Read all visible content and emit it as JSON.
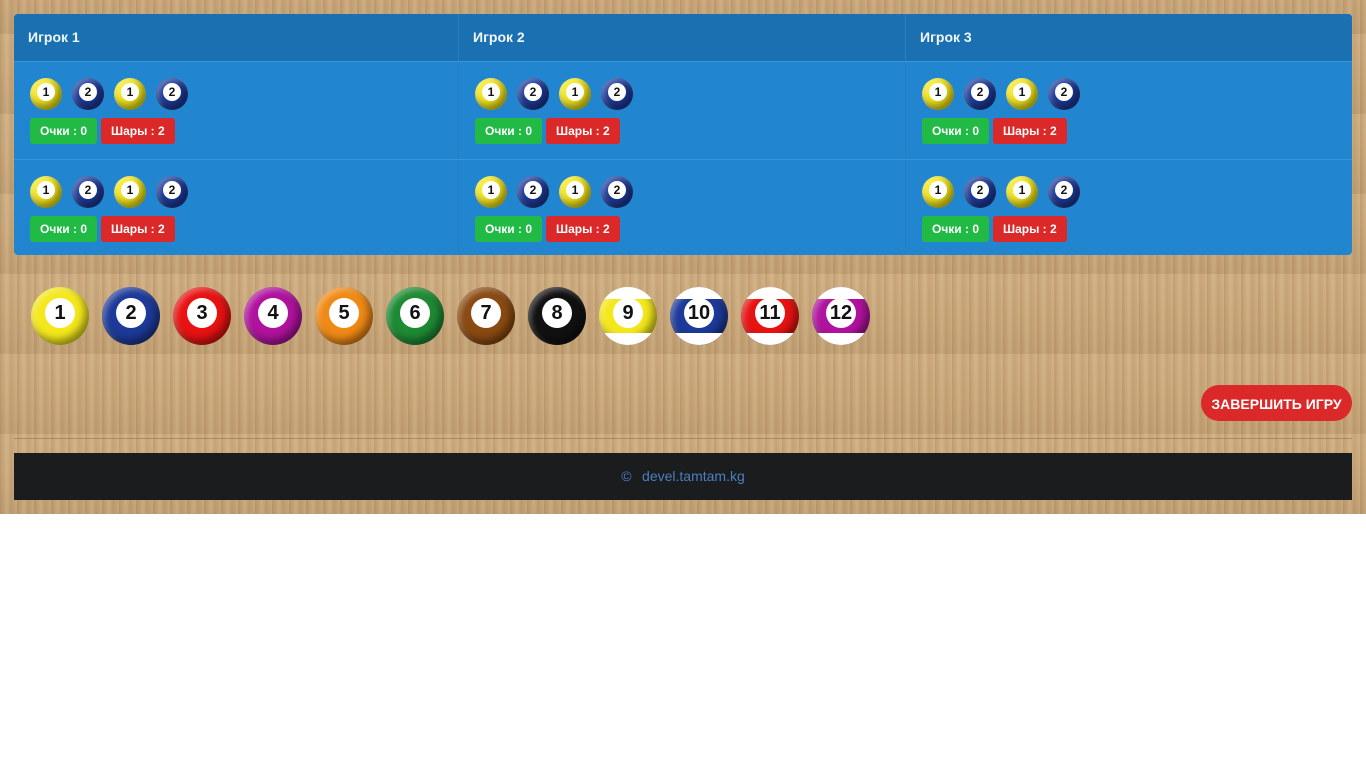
{
  "players": [
    {
      "label": "Игрок 1"
    },
    {
      "label": "Игрок 2"
    },
    {
      "label": "Игрок 3"
    }
  ],
  "rows": [
    {
      "cells": [
        {
          "balls": [
            "1",
            "2",
            "1",
            "2"
          ],
          "points": "Очки : 0",
          "ball_count": "Шары : 2"
        },
        {
          "balls": [
            "1",
            "2",
            "1",
            "2"
          ],
          "points": "Очки : 0",
          "ball_count": "Шары : 2"
        },
        {
          "balls": [
            "1",
            "2",
            "1",
            "2"
          ],
          "points": "Очки : 0",
          "ball_count": "Шары : 2"
        }
      ]
    },
    {
      "cells": [
        {
          "balls": [
            "1",
            "2",
            "1",
            "2"
          ],
          "points": "Очки : 0",
          "ball_count": "Шары : 2"
        },
        {
          "balls": [
            "1",
            "2",
            "1",
            "2"
          ],
          "points": "Очки : 0",
          "ball_count": "Шары : 2"
        },
        {
          "balls": [
            "1",
            "2",
            "1",
            "2"
          ],
          "points": "Очки : 0",
          "ball_count": "Шары : 2"
        }
      ]
    }
  ],
  "ball_picker": [
    {
      "number": "1",
      "color": "#f4e81c",
      "striped": false
    },
    {
      "number": "2",
      "color": "#1d3a9a",
      "striped": false
    },
    {
      "number": "3",
      "color": "#e81212",
      "striped": false
    },
    {
      "number": "4",
      "color": "#b0129e",
      "striped": false
    },
    {
      "number": "5",
      "color": "#f08a16",
      "striped": false
    },
    {
      "number": "6",
      "color": "#1e8a33",
      "striped": false
    },
    {
      "number": "7",
      "color": "#8a4a12",
      "striped": false
    },
    {
      "number": "8",
      "color": "#111111",
      "striped": false
    },
    {
      "number": "9",
      "color": "#f4e81c",
      "striped": true
    },
    {
      "number": "10",
      "color": "#1d3a9a",
      "striped": true
    },
    {
      "number": "11",
      "color": "#e81212",
      "striped": true
    },
    {
      "number": "12",
      "color": "#b0129e",
      "striped": true
    }
  ],
  "small_ball_colors": {
    "1": "#f4e81c",
    "2": "#1d3a9a"
  },
  "finish_button": "ЗАВЕРШИТЬ ИГРУ",
  "footer": {
    "copyright_symbol": "©",
    "text": "devel.tamtam.kg"
  }
}
